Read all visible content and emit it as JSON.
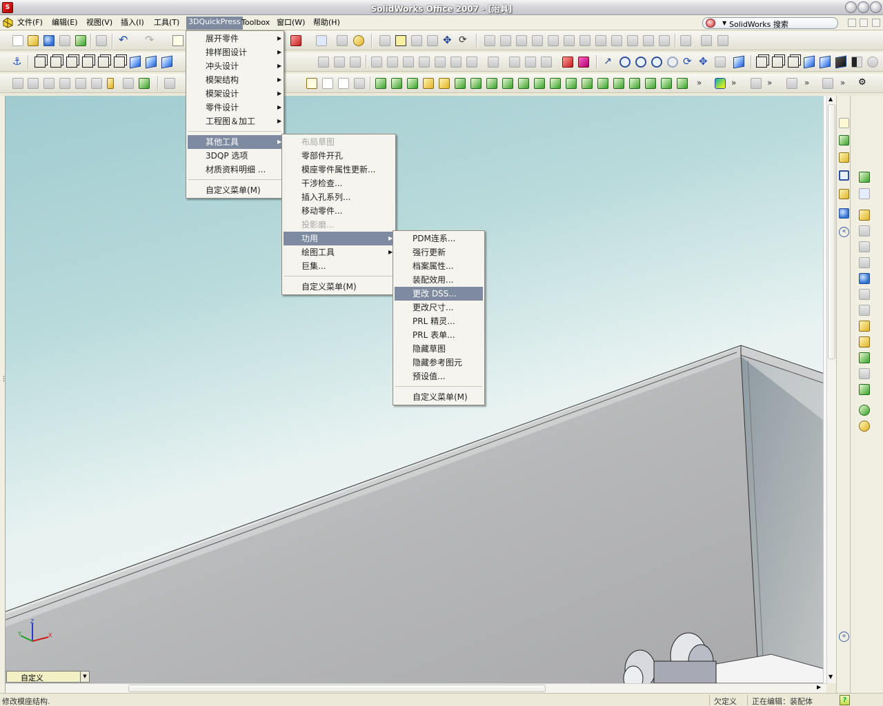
{
  "window": {
    "title": "SolidWorks Office 2007 - [治具]",
    "app_icon": "solidworks-icon"
  },
  "menubar": {
    "items": [
      "文件(F)",
      "编辑(E)",
      "视图(V)",
      "插入(I)",
      "工具(T)",
      "3DQuickPress",
      "Toolbox",
      "窗口(W)",
      "帮助(H)"
    ],
    "active": "3DQuickPress",
    "search_label": "SolidWorks 搜索"
  },
  "menu_3dqp": {
    "items": [
      {
        "label": "展开零件",
        "submenu": true
      },
      {
        "label": "排样图设计",
        "submenu": true
      },
      {
        "label": "冲头设计",
        "submenu": true
      },
      {
        "label": "模架结构",
        "submenu": true
      },
      {
        "label": "模架设计",
        "submenu": true
      },
      {
        "label": "零件设计",
        "submenu": true
      },
      {
        "label": "工程图＆加工",
        "submenu": true
      },
      {
        "label": "其他工具",
        "submenu": true,
        "highlighted": true
      },
      {
        "label": "3DQP 选项"
      },
      {
        "label": "材质资料明细 ..."
      },
      {
        "label": "自定义菜单(M)"
      }
    ]
  },
  "menu_other": {
    "items": [
      {
        "label": "布局草图",
        "disabled": true
      },
      {
        "label": "零部件开孔"
      },
      {
        "label": "模座零件属性更新..."
      },
      {
        "label": "干涉检查..."
      },
      {
        "label": "插入孔系列..."
      },
      {
        "label": "移动零件..."
      },
      {
        "label": "投影磨...",
        "disabled": true
      },
      {
        "label": "功用",
        "submenu": true,
        "highlighted": true
      },
      {
        "label": "绘图工具",
        "submenu": true
      },
      {
        "label": "巨集..."
      },
      {
        "label": "自定义菜单(M)"
      }
    ]
  },
  "menu_util": {
    "items": [
      {
        "label": "PDM连系..."
      },
      {
        "label": "强行更新"
      },
      {
        "label": "档案属性..."
      },
      {
        "label": "装配效用..."
      },
      {
        "label": "更改 DSS...",
        "highlighted": true
      },
      {
        "label": "更改尺寸..."
      },
      {
        "label": "PRL 精灵..."
      },
      {
        "label": "PRL 表单..."
      },
      {
        "label": "隐藏草图"
      },
      {
        "label": "隐藏参考图元"
      },
      {
        "label": "预设值..."
      },
      {
        "label": "自定义菜单(M)"
      }
    ]
  },
  "config": {
    "value": "自定义"
  },
  "statusbar": {
    "message": "修改模座结构.",
    "state": "欠定义",
    "editing": "正在编辑：装配体"
  },
  "triad": {
    "x": "X",
    "y": "Y",
    "z": "Z"
  },
  "colors": {
    "highlight": "#7e8aa0",
    "menubar": "#f1efe2",
    "viewport_top": "#9fcbd0"
  }
}
